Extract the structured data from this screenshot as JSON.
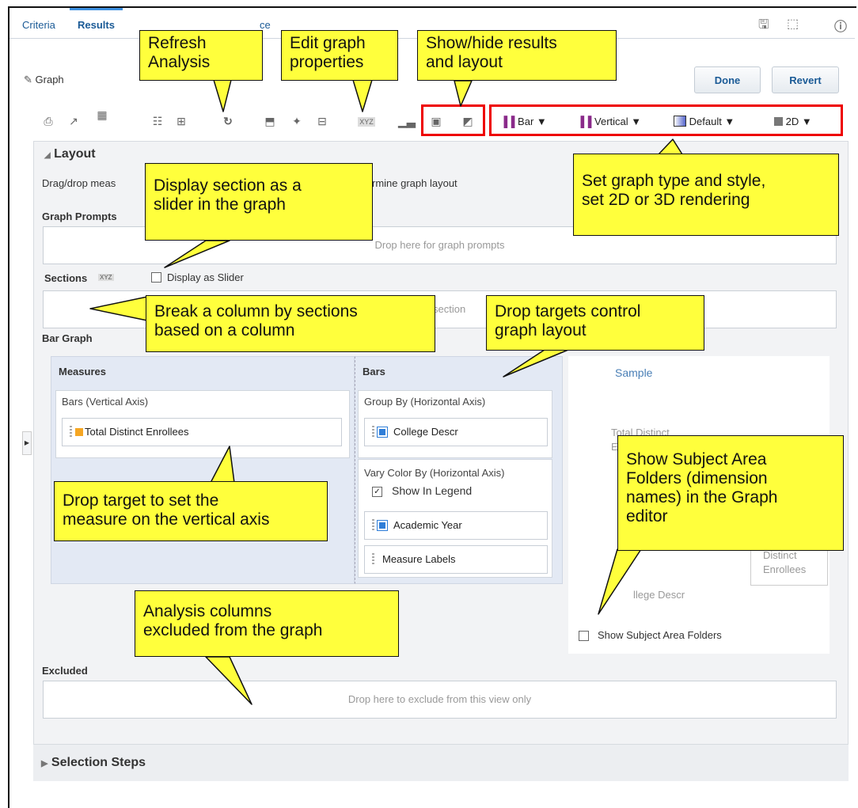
{
  "tabs": [
    {
      "label": "Criteria",
      "active": false
    },
    {
      "label": "Results",
      "active": true
    },
    {
      "label": "ce",
      "active": false
    }
  ],
  "header": {
    "graph_label": "Graph",
    "done_label": "Done",
    "revert_label": "Revert"
  },
  "toolbar": {
    "bar_type": "Bar ▼",
    "orientation": "Vertical ▼",
    "style": "Default ▼",
    "rendering": "2D ▼"
  },
  "layout": {
    "title": "Layout",
    "instruction_a": "Drag/drop meas",
    "instruction_b": "rmine graph layout",
    "graph_prompts_label": "Graph Prompts",
    "graph_prompts_drop": "Drop here for graph prompts",
    "sections_label": "Sections",
    "display_as_slider": "Display as Slider",
    "sections_drop": "section",
    "bar_graph_label": "Bar Graph",
    "measures": {
      "title": "Measures",
      "vertical_axis": "Bars (Vertical Axis)",
      "item": "Total Distinct Enrollees"
    },
    "bars": {
      "title": "Bars",
      "group_by": "Group By (Horizontal Axis)",
      "group_by_item": "College Descr",
      "vary_color": "Vary Color By (Horizontal Axis)",
      "show_in_legend": "Show In Legend",
      "vary_items": [
        "Academic Year",
        "Measure Labels"
      ]
    },
    "sample": {
      "title": "Sample",
      "text1": "Total Distinct",
      "text2": "E",
      "text3": "Distinct",
      "text4": "Enrollees",
      "text5": "llege Descr"
    },
    "show_subject_area_folders": "Show Subject Area Folders",
    "excluded_label": "Excluded",
    "excluded_drop": "Drop here to exclude from this view only"
  },
  "selection_steps": "Selection Steps",
  "callouts": {
    "refresh": "Refresh\nAnalysis",
    "edit_graph": "Edit graph\nproperties",
    "show_hide": "Show/hide results\nand layout",
    "graph_type": "Set graph type and style,\nset 2D or 3D rendering",
    "slider": "Display section as a\nslider in the graph",
    "break_column": "Break a column by sections\nbased on a column",
    "drop_targets": "Drop targets control\ngraph layout",
    "subject_area": "Show Subject Area\nFolders (dimension\nnames) in the Graph\neditor",
    "measure_target": "Drop target to set the\nmeasure on the vertical axis",
    "excluded": "Analysis columns\nexcluded from the graph"
  },
  "colors": {
    "callout": "#ffff3c",
    "highlight_border": "#ee0000",
    "link": "#1a5a96",
    "bar_icon": "#8a2a8a"
  }
}
